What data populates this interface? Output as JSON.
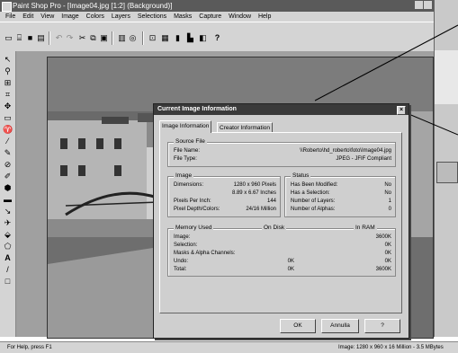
{
  "window": {
    "title": "Paint Shop Pro - [Image04.jpg [1:2] (Background)]"
  },
  "menu": [
    "File",
    "Edit",
    "View",
    "Image",
    "Colors",
    "Layers",
    "Selections",
    "Masks",
    "Capture",
    "Window",
    "Help"
  ],
  "toolbar_icons": [
    "new-icon",
    "open-icon",
    "save-icon",
    "print-icon",
    "undo-icon",
    "redo-icon",
    "cut-icon",
    "copy-icon",
    "paste-icon",
    "browse-icon",
    "zoom-icon",
    "tool-palette-icon",
    "color-palette-icon",
    "layer-icon",
    "histogram-icon",
    "help-icon"
  ],
  "tools": [
    "select-arrow-icon",
    "zoom-tool-icon",
    "deform-icon",
    "crop-icon",
    "move-icon",
    "selection-icon",
    "lasso-icon",
    "dropper-icon",
    "paintbrush-icon",
    "clone-icon",
    "color-replacer-icon",
    "retouch-icon",
    "eraser-icon",
    "scratch-remover-icon",
    "airbrush-icon",
    "flood-fill-icon",
    "picture-tube-icon",
    "text-icon",
    "line-icon",
    "shape-icon"
  ],
  "status": {
    "left": "For Help, press F1",
    "right": "Image: 1280 x 960 x 16 Million - 3.5 MBytes"
  },
  "dialog": {
    "title": "Current Image Information",
    "tabs": [
      "Image Information",
      "Creator Information"
    ],
    "source": {
      "label": "Source File",
      "file_name_label": "File Name:",
      "file_name": "\\\\Roberto\\hd_roberto\\foto\\Image04.jpg",
      "file_type_label": "File Type:",
      "file_type": "JPEG - JFIF Compliant"
    },
    "image": {
      "label": "Image",
      "dimensions_label": "Dimensions:",
      "dimensions_px": "1280 x 960 Pixels",
      "dimensions_in": "8.89 x 6.67 Inches",
      "ppi_label": "Pixels Per Inch:",
      "ppi": "144",
      "depth_label": "Pixel Depth/Colors:",
      "depth": "24/16 Million"
    },
    "status": {
      "label": "Status",
      "modified_label": "Has Been Modified:",
      "modified": "No",
      "selection_label": "Has a Selection:",
      "selection": "No",
      "layers_label": "Number of Layers:",
      "layers": "1",
      "alphas_label": "Number of Alphas:",
      "alphas": "0"
    },
    "memory": {
      "label": "Memory Used",
      "on_disk": "On Disk",
      "in_ram": "In RAM",
      "rows": [
        {
          "name": "Image:",
          "disk": "",
          "ram": "3600K"
        },
        {
          "name": "Selection:",
          "disk": "",
          "ram": "0K"
        },
        {
          "name": "Masks & Alpha Channels:",
          "disk": "",
          "ram": "0K"
        },
        {
          "name": "Undo:",
          "disk": "0K",
          "ram": "0K"
        },
        {
          "name": "Total:",
          "disk": "0K",
          "ram": "3600K"
        }
      ]
    },
    "buttons": {
      "ok": "OK",
      "cancel": "Annulla",
      "help": "?"
    }
  }
}
